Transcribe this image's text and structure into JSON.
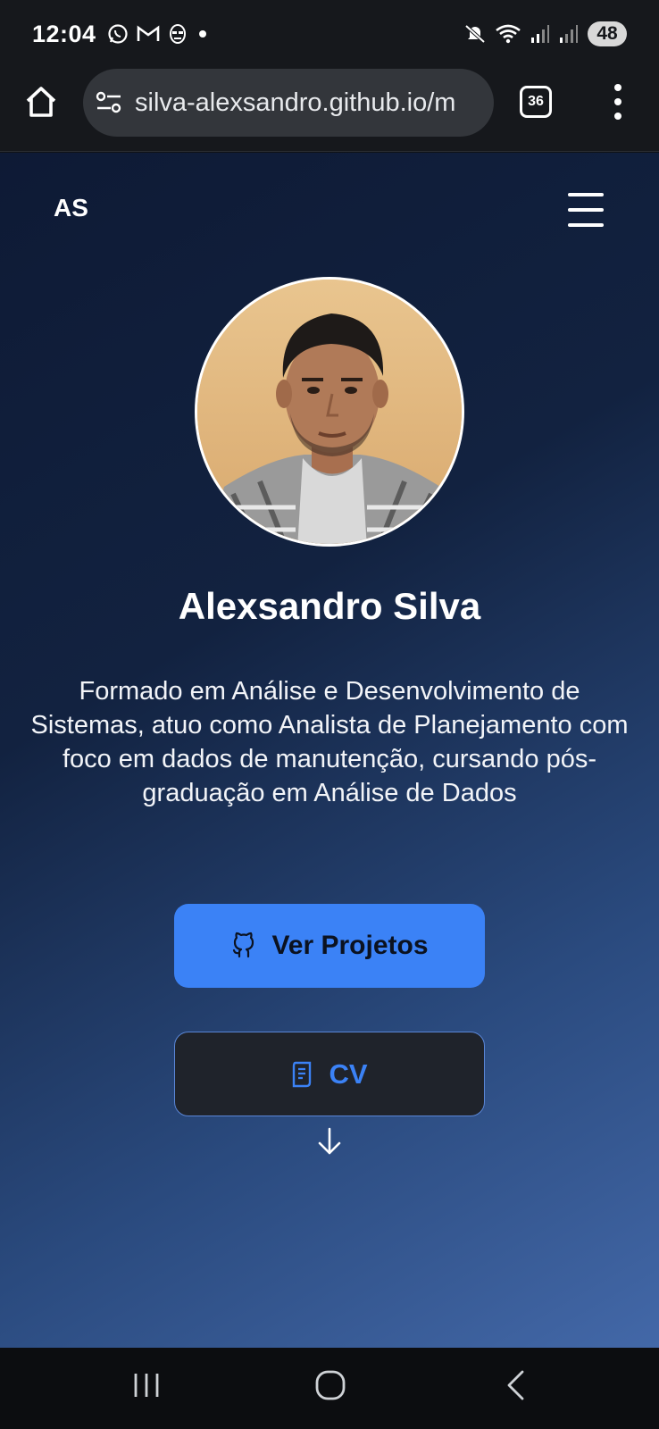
{
  "status_bar": {
    "time": "12:04",
    "battery": "48",
    "icons": [
      "whatsapp-icon",
      "gmail-icon",
      "notification-face-icon",
      "dot-icon",
      "mute-icon",
      "wifi-icon",
      "signal-icon",
      "signal-icon"
    ]
  },
  "browser": {
    "url": "silva-alexsandro.github.io/m",
    "tab_count": "36"
  },
  "page": {
    "brand": "AS",
    "name": "Alexsandro Silva",
    "bio": "Formado em Análise e Desenvolvimento de Sistemas, atuo como Analista de Planejamento com foco em dados de manutenção, cursando pós-graduação em Análise de Dados",
    "projects_button": "Ver Projetos",
    "cv_button": "CV"
  },
  "colors": {
    "accent": "#3b82f6",
    "gradient_start": "#0e1a35",
    "gradient_end": "#4368a8"
  }
}
